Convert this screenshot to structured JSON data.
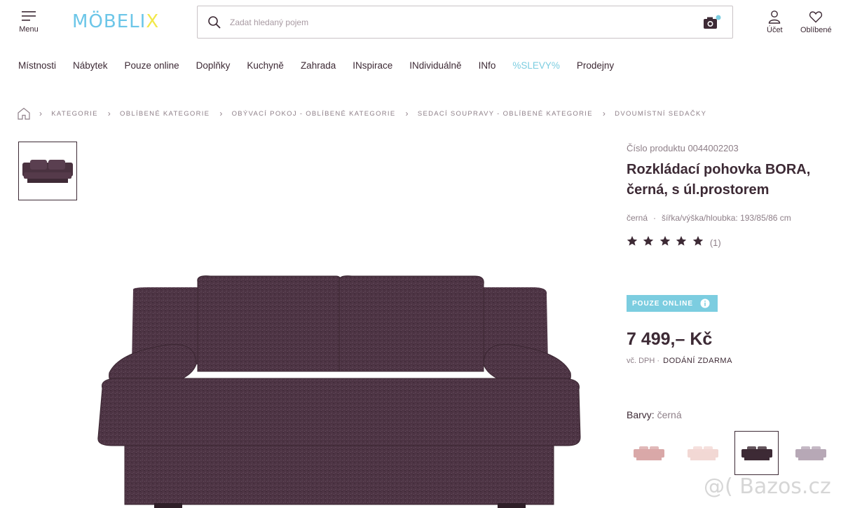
{
  "header": {
    "menu_label": "Menu",
    "logo_main": "MÖBELI",
    "logo_x": "X",
    "search_placeholder": "Zadat hledaný pojem",
    "account_label": "Účet",
    "favorites_label": "Oblíbené"
  },
  "nav": [
    "Místnosti",
    "Nábytek",
    "Pouze online",
    "Doplňky",
    "Kuchyně",
    "Zahrada",
    "INspirace",
    "INdividuálně",
    "INfo",
    "%SLEVY%",
    "Prodejny"
  ],
  "breadcrumb": [
    "KATEGORIE",
    "OBLÍBENÉ KATEGORIE",
    "OBÝVACÍ POKOJ - OBLÍBENÉ KATEGORIE",
    "SEDACÍ SOUPRAVY - OBLÍBENÉ KATEGORIE",
    "DVOUMÍSTNÍ SEDAČKY"
  ],
  "product": {
    "number_label": "Číslo produktu",
    "number": "0044002203",
    "title_bold": "Rozkládací",
    "title_rest": " pohovka BORA, černá, s úl.prostorem",
    "color_spec": "černá",
    "dimensions": "šířka/výška/hloubka: 193/85/86 cm",
    "rating": 5,
    "rating_count": "(1)",
    "badge": "POUZE ONLINE",
    "price": "7 499,– Kč",
    "vat": "vč. DPH",
    "delivery": "DODÁNÍ ZDARMA",
    "colors_label": "Barvy:",
    "colors_value": "černá"
  },
  "swatches": [
    {
      "color": "#d9a8a8",
      "selected": false
    },
    {
      "color": "#f2d8d4",
      "selected": false
    },
    {
      "color": "#3d2a35",
      "selected": true
    },
    {
      "color": "#b7a8b6",
      "selected": false
    }
  ],
  "colors": {
    "text": "#3d2a35",
    "accent": "#7ccde0",
    "sofa": "#4a3240"
  },
  "watermark": "@( Bazos.cz"
}
